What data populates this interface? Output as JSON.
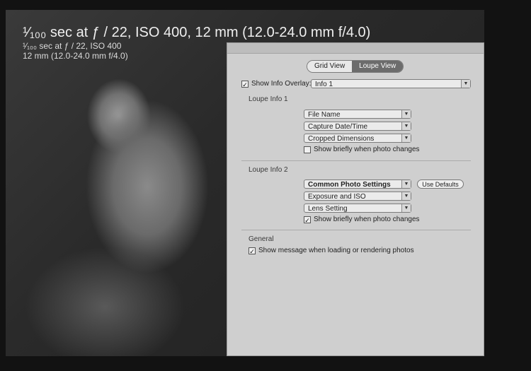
{
  "photo_info": {
    "line1": "¹⁄₁₀₀ sec at ƒ / 22, ISO 400, 12 mm (12.0-24.0 mm f/4.0)",
    "line2": "¹⁄₁₀₀ sec at ƒ / 22, ISO 400",
    "line3": "12 mm (12.0-24.0 mm f/4.0)"
  },
  "dialog": {
    "tabs": [
      {
        "label": "Grid View",
        "selected": false
      },
      {
        "label": "Loupe View",
        "selected": true
      }
    ],
    "show_info_overlay": {
      "label": "Show Info Overlay:",
      "checked": true,
      "value": "Info 1"
    },
    "loupe_info_1": {
      "label": "Loupe Info 1",
      "fields": [
        "File Name",
        "Capture Date/Time",
        "Cropped Dimensions"
      ],
      "show_briefly_label": "Show briefly when photo changes",
      "show_briefly_checked": false
    },
    "loupe_info_2": {
      "label": "Loupe Info 2",
      "fields": [
        "Common Photo Settings",
        "Exposure and ISO",
        "Lens Setting"
      ],
      "use_defaults_label": "Use Defaults",
      "show_briefly_label": "Show briefly when photo changes",
      "show_briefly_checked": true
    },
    "general": {
      "label": "General",
      "show_message_label": "Show message when loading or rendering photos",
      "show_message_checked": true
    }
  },
  "colors": {
    "accent": "#6c6c6c",
    "dialog_bg": "#cfcfcf",
    "photo_bg": "#2a2a2a"
  }
}
